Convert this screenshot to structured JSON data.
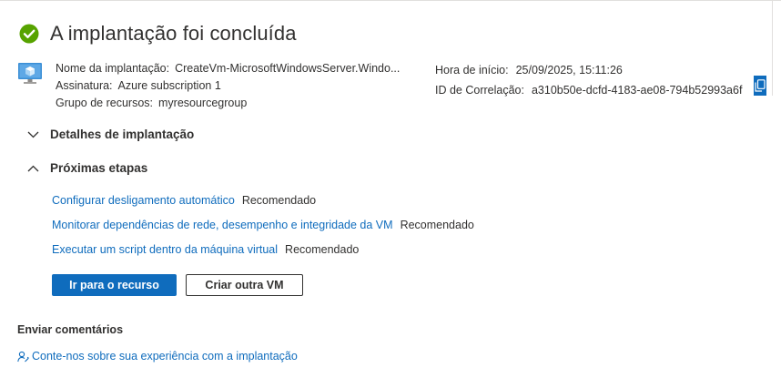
{
  "header": {
    "title": "A implantação foi concluída"
  },
  "deployment": {
    "name_label": "Nome da implantação:",
    "name_value": "CreateVm-MicrosoftWindowsServer.Windo...",
    "subscription_label": "Assinatura:",
    "subscription_value": "Azure subscription 1",
    "resource_group_label": "Grupo de recursos:",
    "resource_group_value": "myresourcegroup",
    "start_time_label": "Hora de início:",
    "start_time_value": "25/09/2025, 15:11:26",
    "correlation_label": "ID de Correlação:",
    "correlation_value": "a310b50e-dcfd-4183-ae08-794b52993a6f"
  },
  "sections": {
    "details": "Detalhes de implantação",
    "next_steps": "Próximas etapas"
  },
  "next_steps": [
    {
      "link": "Configurar desligamento automático",
      "tag": "Recomendado"
    },
    {
      "link": "Monitorar dependências de rede, desempenho e integridade da VM",
      "tag": "Recomendado"
    },
    {
      "link": "Executar um script dentro da máquina virtual",
      "tag": "Recomendado"
    }
  ],
  "buttons": {
    "go_to_resource": "Ir para o recurso",
    "create_another": "Criar outra VM"
  },
  "feedback": {
    "title": "Enviar comentários",
    "link": "Conte-nos sobre sua experiência com a implantação"
  },
  "icons": {
    "status": "check-circle-icon",
    "vm": "virtual-machine-icon",
    "copy": "copy-icon",
    "feedback": "feedback-person-icon"
  },
  "colors": {
    "success": "#57a300",
    "accent": "#0f6cbd",
    "text": "#323130"
  }
}
